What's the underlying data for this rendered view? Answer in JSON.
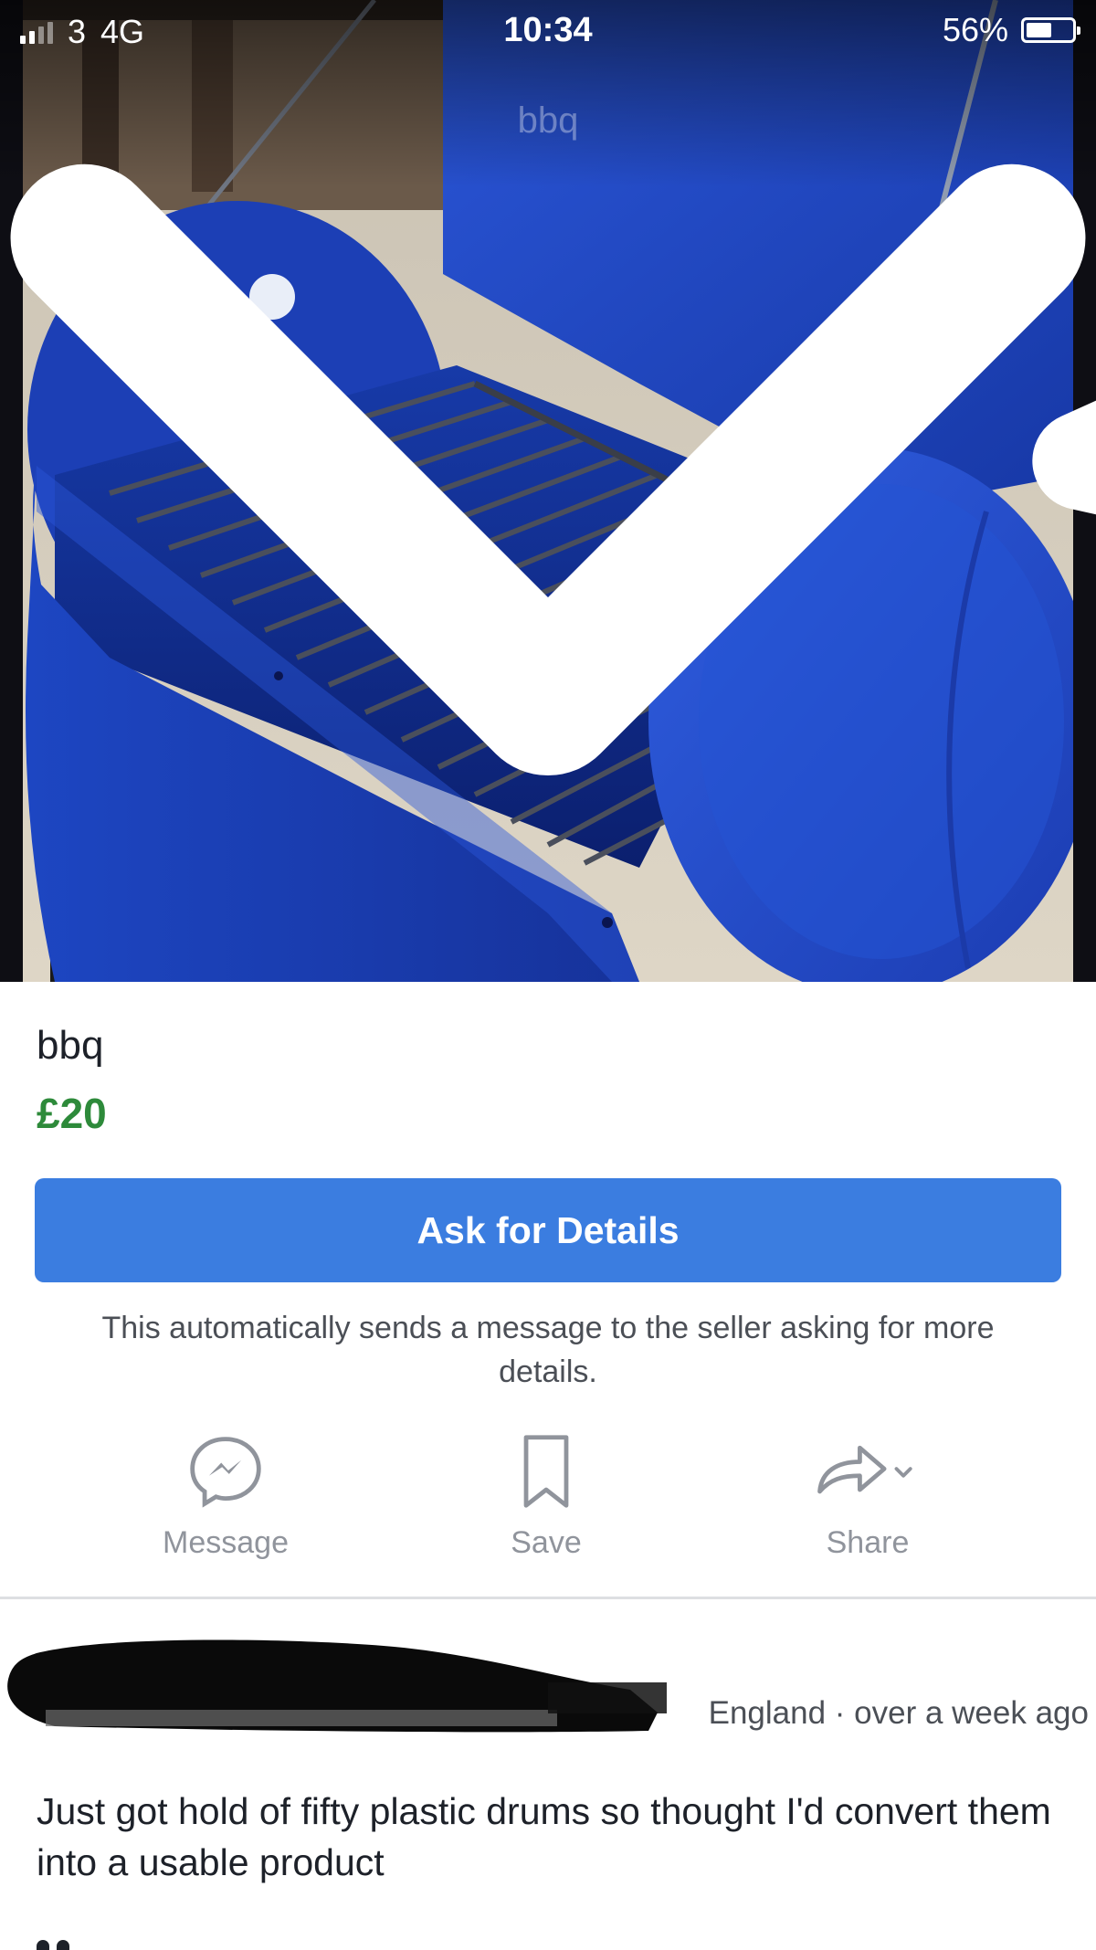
{
  "status_bar": {
    "carrier": "3",
    "network": "4G",
    "time": "10:34",
    "battery": "56%",
    "battery_level": 0.56,
    "icons": [
      "signal-icon",
      "location-arrow-icon",
      "bluetooth-icon",
      "battery-icon"
    ]
  },
  "photo": {
    "overlay_title": "bbq",
    "back_icon": "chevron-down-icon"
  },
  "listing": {
    "title": "bbq",
    "price": "£20"
  },
  "ask": {
    "button_label": "Ask for Details",
    "note": "This automatically sends a message to the seller asking for more details."
  },
  "actions": {
    "message": {
      "label": "Message",
      "icon": "messenger-icon"
    },
    "save": {
      "label": "Save",
      "icon": "bookmark-icon"
    },
    "share": {
      "label": "Share",
      "icon": "share-arrow-icon"
    }
  },
  "seller": {
    "location": "England",
    "posted": "over a week ago",
    "location_line": "England · over a week ago"
  },
  "description": "Just got hold of fifty plastic drums so thought I'd convert them into a usable product",
  "colors": {
    "accent": "#3b7de0",
    "price": "#2d8a3a",
    "barrel_blue": "#1f3fb3",
    "muted_text": "#90949c"
  }
}
